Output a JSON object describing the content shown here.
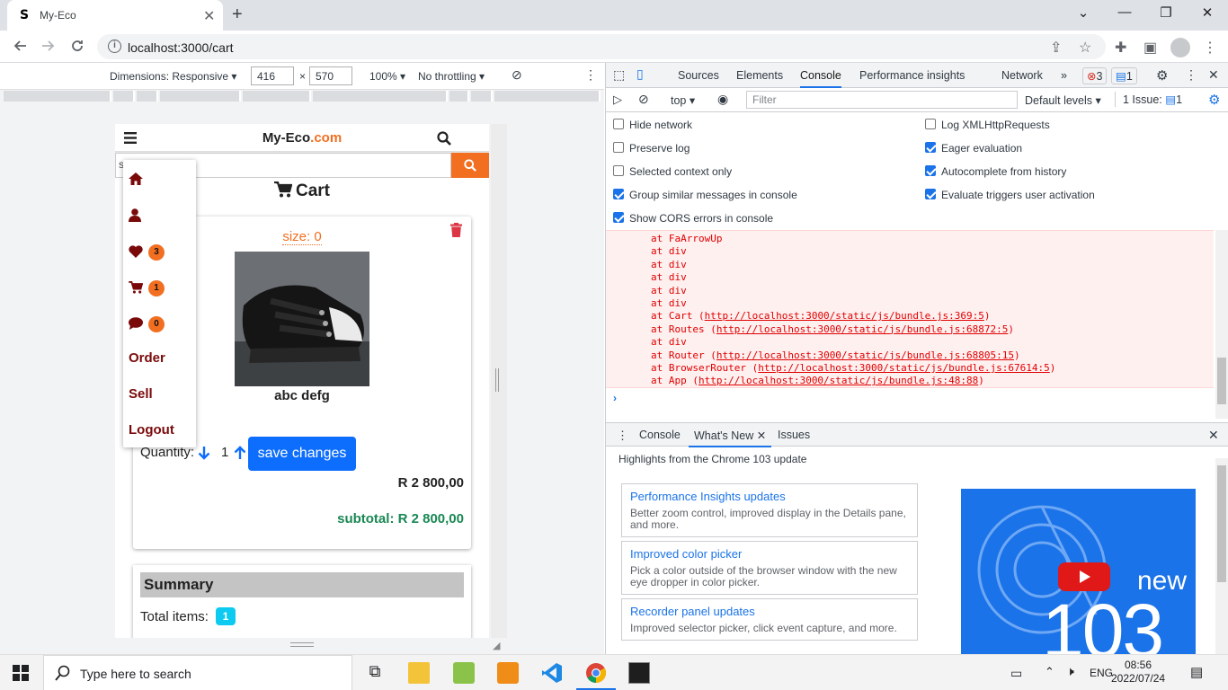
{
  "browser": {
    "tab_title": "My-Eco",
    "tab_favicon": "S",
    "url": "localhost:3000/cart"
  },
  "device_toolbar": {
    "dimensions_label": "Dimensions: Responsive",
    "width_value": "416",
    "times": "×",
    "height_value": "570",
    "zoom": "100%",
    "throttling": "No throttling"
  },
  "app": {
    "brand_main": "My-Eco",
    "brand_suffix": ".com",
    "search_value": "s",
    "cart_title": "Cart",
    "item": {
      "size_label": "size: 0",
      "name": "abc defg",
      "quantity_label": "Quantity:",
      "quantity": "1",
      "save_button": "save changes",
      "price": "R 2 800,00",
      "subtotal": "subtotal: R 2 800,00"
    },
    "summary": {
      "heading": "Summary",
      "total_items_label": "Total items:",
      "total_items": "1"
    },
    "menu": {
      "wishlist_count": "3",
      "cart_count": "1",
      "messages_count": "0",
      "order": "Order",
      "sell": "Sell",
      "logout": "Logout"
    },
    "colors": {
      "accent": "#f26f21",
      "menu_text": "#7a0a0a",
      "primary": "#0d6efd",
      "success": "#198754"
    }
  },
  "devtools": {
    "tabs": [
      "Sources",
      "Elements",
      "Console",
      "Performance insights",
      "Network"
    ],
    "more": "»",
    "errors_count": "3",
    "messages_count": "1",
    "context": "top",
    "filter_placeholder": "Filter",
    "levels": "Default levels",
    "issues_label": "1 Issue:",
    "issues_count": "1",
    "settings": {
      "left": [
        {
          "label": "Hide network",
          "checked": false
        },
        {
          "label": "Preserve log",
          "checked": false
        },
        {
          "label": "Selected context only",
          "checked": false
        },
        {
          "label": "Group similar messages in console",
          "checked": true
        },
        {
          "label": "Show CORS errors in console",
          "checked": true
        }
      ],
      "right": [
        {
          "label": "Log XMLHttpRequests",
          "checked": false
        },
        {
          "label": "Eager evaluation",
          "checked": true
        },
        {
          "label": "Autocomplete from history",
          "checked": true
        },
        {
          "label": "Evaluate triggers user activation",
          "checked": true
        }
      ]
    },
    "stack": [
      {
        "text": "at FaArrowUp",
        "link": ""
      },
      {
        "text": "at div",
        "link": ""
      },
      {
        "text": "at div",
        "link": ""
      },
      {
        "text": "at div",
        "link": ""
      },
      {
        "text": "at div",
        "link": ""
      },
      {
        "text": "at div",
        "link": ""
      },
      {
        "text": "at Cart (",
        "link": "http://localhost:3000/static/js/bundle.js:369:5",
        "end": ")"
      },
      {
        "text": "at Routes (",
        "link": "http://localhost:3000/static/js/bundle.js:68872:5",
        "end": ")"
      },
      {
        "text": "at div",
        "link": ""
      },
      {
        "text": "at Router (",
        "link": "http://localhost:3000/static/js/bundle.js:68805:15",
        "end": ")"
      },
      {
        "text": "at BrowserRouter (",
        "link": "http://localhost:3000/static/js/bundle.js:67614:5",
        "end": ")"
      },
      {
        "text": "at App (",
        "link": "http://localhost:3000/static/js/bundle.js:48:88",
        "end": ")"
      }
    ],
    "prompt": "›",
    "drawer": {
      "tabs": [
        "Console",
        "What's New",
        "Issues"
      ],
      "heading": "Highlights from the Chrome 103 update",
      "cards": [
        {
          "title": "Performance Insights updates",
          "desc": "Better zoom control, improved display in the Details pane, and more."
        },
        {
          "title": "Improved color picker",
          "desc": "Pick a color outside of the browser window with the new eye dropper in color picker."
        },
        {
          "title": "Recorder panel updates",
          "desc": "Improved selector picker, click event capture, and more."
        }
      ],
      "banner_new": "new",
      "banner_version": "103"
    }
  },
  "taskbar": {
    "search_placeholder": "Type here to search",
    "language": "ENG",
    "time": "08:56",
    "date": "2022/07/24"
  }
}
